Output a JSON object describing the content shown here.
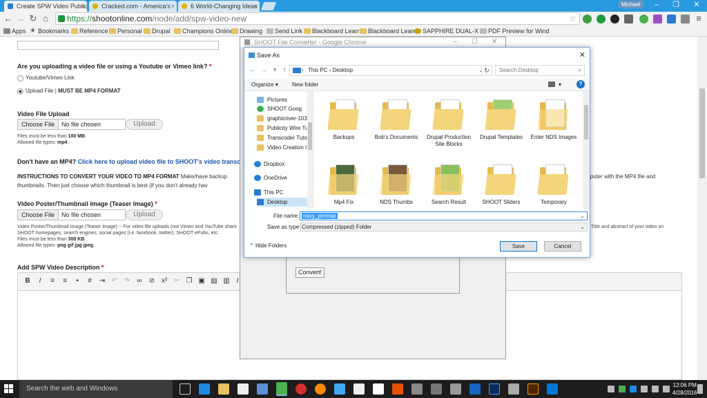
{
  "browser": {
    "tabs": [
      {
        "title": "Create SPW Video Publicit",
        "active": true,
        "color": "#2a7ad0"
      },
      {
        "title": "Cracked.com - America's",
        "active": false,
        "color": "#e0b000"
      },
      {
        "title": "6 World-Changing Ideas t",
        "active": false,
        "color": "#e0b000"
      }
    ],
    "user": "Michael",
    "url_scheme": "https://",
    "url_host": "shootonline.com",
    "url_path": "/node/add/spw-video-new",
    "bookmarks": [
      "Apps",
      "Bookmarks",
      "Reference",
      "Personal",
      "Drupal",
      "Champions Online",
      "Drawing",
      "Send Link",
      "Blackboard Learn",
      "Blackboard Learn",
      "SAPPHIRE DUAL-X 10",
      "PDF Preview for Wind"
    ]
  },
  "form": {
    "q_upload": "Are you uploading a video file or using a Youtube or Vimeo link?",
    "req": "*",
    "radio_link": "Youtube/Vimeo Link",
    "radio_upload": "Upload File",
    "radio_upload_note": "MUST BE MP4 FORMAT",
    "video_upload_label": "Video File Upload",
    "choose_file": "Choose File",
    "no_file": "No file chosen",
    "upload": "Upload",
    "video_size_prefix": "Files must be less than",
    "video_size": "100 MB",
    "video_types_prefix": "Allowed file types:",
    "video_types": "mp4",
    "no_mp4_q": "Don't have an MP4?",
    "no_mp4_link": "Click here to upload video file to SHOOT's video transcod",
    "instr_bold": "INSTRUCTIONS TO CONVERT YOUR VIDEO TO MP4 FORMAT",
    "instr_text": "Make/have backup",
    "instr_right": "mputer with the MP4 file and",
    "instr_line2": "thumbnails. Then just choose which thumbnail is best (if you don't already hav",
    "poster_label": "Video Poster/Thumbnail Image (Teaser Image)",
    "poster_desc": "Video Poster/Thumbnail Image (Teaser Image) -- For video file uploads (not Vimeo and YouTube sharir",
    "poster_desc_right": "Title and abstract of your video on",
    "poster_desc2": "SHOOT homepages, search engines, social pages (i.e. facebook, twitter), SHOOT ePubs, etc.",
    "poster_size": "300 KB",
    "poster_types": "png gif jpg jpeg",
    "desc_label": "Add SPW Video Description"
  },
  "converter": {
    "title": "SHOOT File Converter - Google Chrome",
    "convert": "Convert!"
  },
  "dialog": {
    "title": "Save As",
    "path": [
      "This PC",
      "Desktop"
    ],
    "search_placeholder": "Search Desktop",
    "organize": "Organize",
    "new_folder": "New folder",
    "help": "?",
    "nav": [
      {
        "label": "Pictures",
        "pin": true
      },
      {
        "label": "SHOOT Goog",
        "pin": true
      },
      {
        "label": "graphicriver-103",
        "pin": false
      },
      {
        "label": "Publicity Wire Tu",
        "pin": false
      },
      {
        "label": "Transcoder Tuto",
        "pin": false
      },
      {
        "label": "Video Creation I",
        "pin": false
      },
      {
        "label": "Dropbox",
        "pin": false
      },
      {
        "label": "OneDrive",
        "pin": false
      },
      {
        "label": "This PC",
        "pin": false
      },
      {
        "label": "Desktop",
        "pin": false
      }
    ],
    "folders_row1": [
      "Backups",
      "Bob's Documents",
      "Drupal Production Site Blocks",
      "Drupal Templates",
      "Enter NDS Images"
    ],
    "folders_row2": [
      "Mp4 Fix",
      "NDS Thumbs",
      "Search Result",
      "SHOOT Sliders",
      "Temporary"
    ],
    "file_name_label": "File name:",
    "file_name": "navy_pinmap",
    "save_type_label": "Save as type:",
    "save_type": "Compressed (zipped) Folder",
    "hide_folders": "Hide Folders",
    "save": "Save",
    "cancel": "Cancel"
  },
  "taskbar": {
    "search": "Search the web and Windows",
    "time": "12:06 PM",
    "date": "4/28/2016"
  }
}
